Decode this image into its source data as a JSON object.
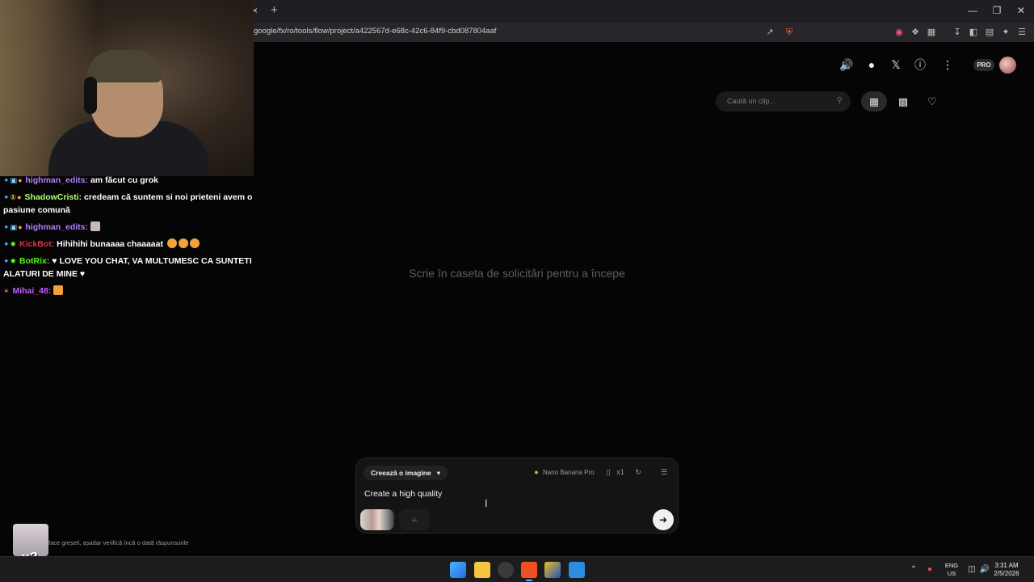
{
  "browser": {
    "url": "google/fx/ro/tools/flow/project/a422567d-e68c-42c6-84f9-cbd087804aaf",
    "new_tab_symbol": "+",
    "close_symbol": "×"
  },
  "header": {
    "pro_label": "PRO"
  },
  "gallery": {
    "search_placeholder": "Caută un clip..."
  },
  "main": {
    "empty_message": "Scrie în caseta de solicitări pentru a începe"
  },
  "composer": {
    "mode_label": "Creează o imagine",
    "model_label": "Nano Banana Pro",
    "count_label": "x1",
    "prompt_text": "Create a high quality"
  },
  "chat": {
    "messages": [
      {
        "user": "highman_edits:",
        "user_color": "#b77cff",
        "text": "am făcut cu grok"
      },
      {
        "user": "ShadowCristi:",
        "user_color": "#b6ff6b",
        "text": "credeam că suntem si noi prieteni avem o pasiune comună"
      },
      {
        "user": "highman_edits:",
        "user_color": "#b77cff",
        "text": ""
      },
      {
        "user": "KickBot:",
        "user_color": "#e0313f",
        "text": "Hihihihi bunaaaa chaaaaat"
      },
      {
        "user": "BotRix:",
        "user_color": "#53fc18",
        "text": "LOVE YOU CHAT, VA MULTUMESC CA SUNTETI ALATURI DE MINE"
      },
      {
        "user": "Mihai_48:",
        "user_color": "#c45dff",
        "text": ""
      }
    ],
    "sub_multiplier": "x2",
    "disclaimer": "face greșeli, așadar verifică încă o dată răspunsurile"
  },
  "taskbar": {
    "lang_line1": "ENG",
    "lang_line2": "US",
    "time": "3:31 AM",
    "date": "2/5/2026"
  },
  "colors": {
    "accent_blue": "#6aa7ff",
    "kick_green": "#53fc18"
  }
}
